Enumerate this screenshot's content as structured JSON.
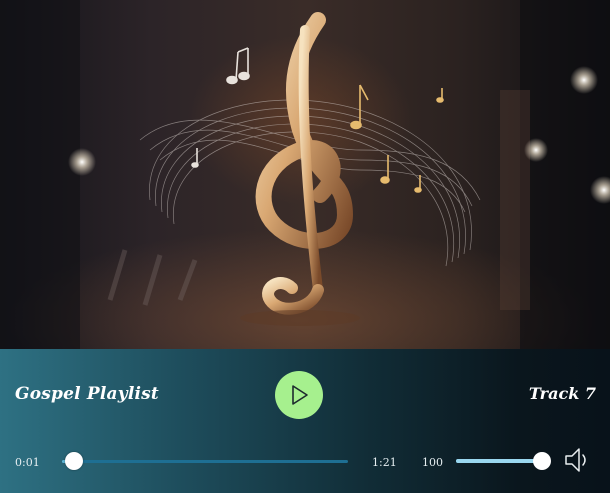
{
  "player": {
    "title": "Gospel Playlist",
    "track": "Track 7",
    "time_current": "0:01",
    "time_duration": "1:21",
    "progress_fraction": 0.0123,
    "volume_label": "100",
    "volume_fraction": 1.0,
    "colors": {
      "play_button": "#a6f08e",
      "track": "#1e6f93",
      "thumb": "#ffffff"
    },
    "icons": {
      "play": "play-icon",
      "volume": "speaker-icon",
      "artwork": "treble-clef-artwork"
    }
  }
}
